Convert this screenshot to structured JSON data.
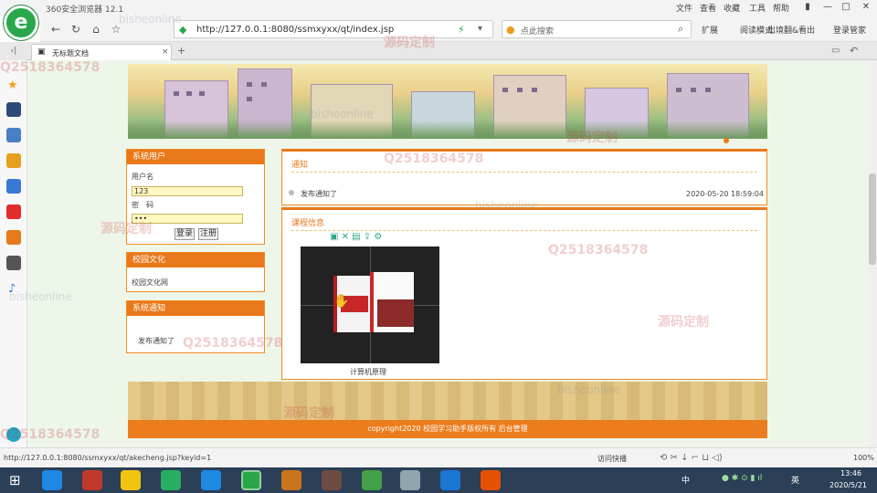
{
  "browser": {
    "title": "360安全浏览器 12.1",
    "menus": [
      "文件",
      "查看",
      "收藏",
      "工具",
      "帮助"
    ],
    "address": "http://127.0.0.1:8080/ssmxyxx/qt/index.jsp",
    "search_placeholder": "点此搜索",
    "toolbar": {
      "ext": "扩展",
      "read": "阅读模式",
      "translate": "出境翻&看出",
      "login": "登录管家"
    },
    "tab_title": "无标题文档",
    "status_url": "http://127.0.0.1:8080/ssmxyxx/qt/akecheng.jsp?keyid=1",
    "zoom": "100%",
    "status_tool": "访问快播"
  },
  "panels": {
    "login": {
      "title": "系统用户",
      "user_label": "用户名",
      "user_value": "123",
      "pass_label": "密　码",
      "pass_value": "•••",
      "login_btn": "登录",
      "register_btn": "注册"
    },
    "culture": {
      "title": "校园文化",
      "item": "校园文化网"
    },
    "notice": {
      "title": "系统通知",
      "item": "发布通知了"
    }
  },
  "main": {
    "notice_title": "通知",
    "notice_item": "发布通知了",
    "notice_time": "2020-05-20 18:59:04",
    "course_title": "课程信息",
    "course_name": "计算机原理"
  },
  "footer": {
    "text": "copyright2020 校园学习助手版权所有  后台管理"
  },
  "watermarks": {
    "a": "bisheonline",
    "b": "源码定制",
    "c": "Q2518364578"
  },
  "taskbar": {
    "ime": "中",
    "lang": "英",
    "time": "13:46",
    "date": "2020/5/21"
  }
}
